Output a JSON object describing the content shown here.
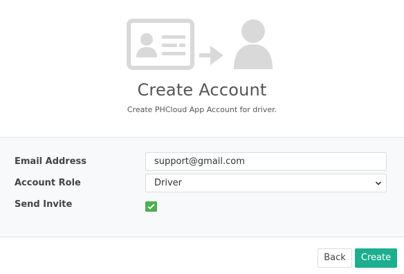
{
  "header": {
    "title": "Create Account",
    "subtitle": "Create PHCloud App Account for driver."
  },
  "form": {
    "email": {
      "label": "Email Address",
      "value": "support@gmail.com"
    },
    "role": {
      "label": "Account Role",
      "selected": "Driver"
    },
    "invite": {
      "label": "Send Invite",
      "checked": true
    }
  },
  "footer": {
    "back_label": "Back",
    "create_label": "Create"
  },
  "icons": {
    "illustration": [
      "id-card-icon",
      "arrow-right-icon",
      "user-icon"
    ],
    "select": "chevron-down-icon",
    "checkbox": "check-icon"
  },
  "colors": {
    "illustration": "#d9d9d9",
    "primary": "#1cae8f",
    "checkbox": "#4caf50",
    "panel_bg": "#f8f9fa"
  }
}
